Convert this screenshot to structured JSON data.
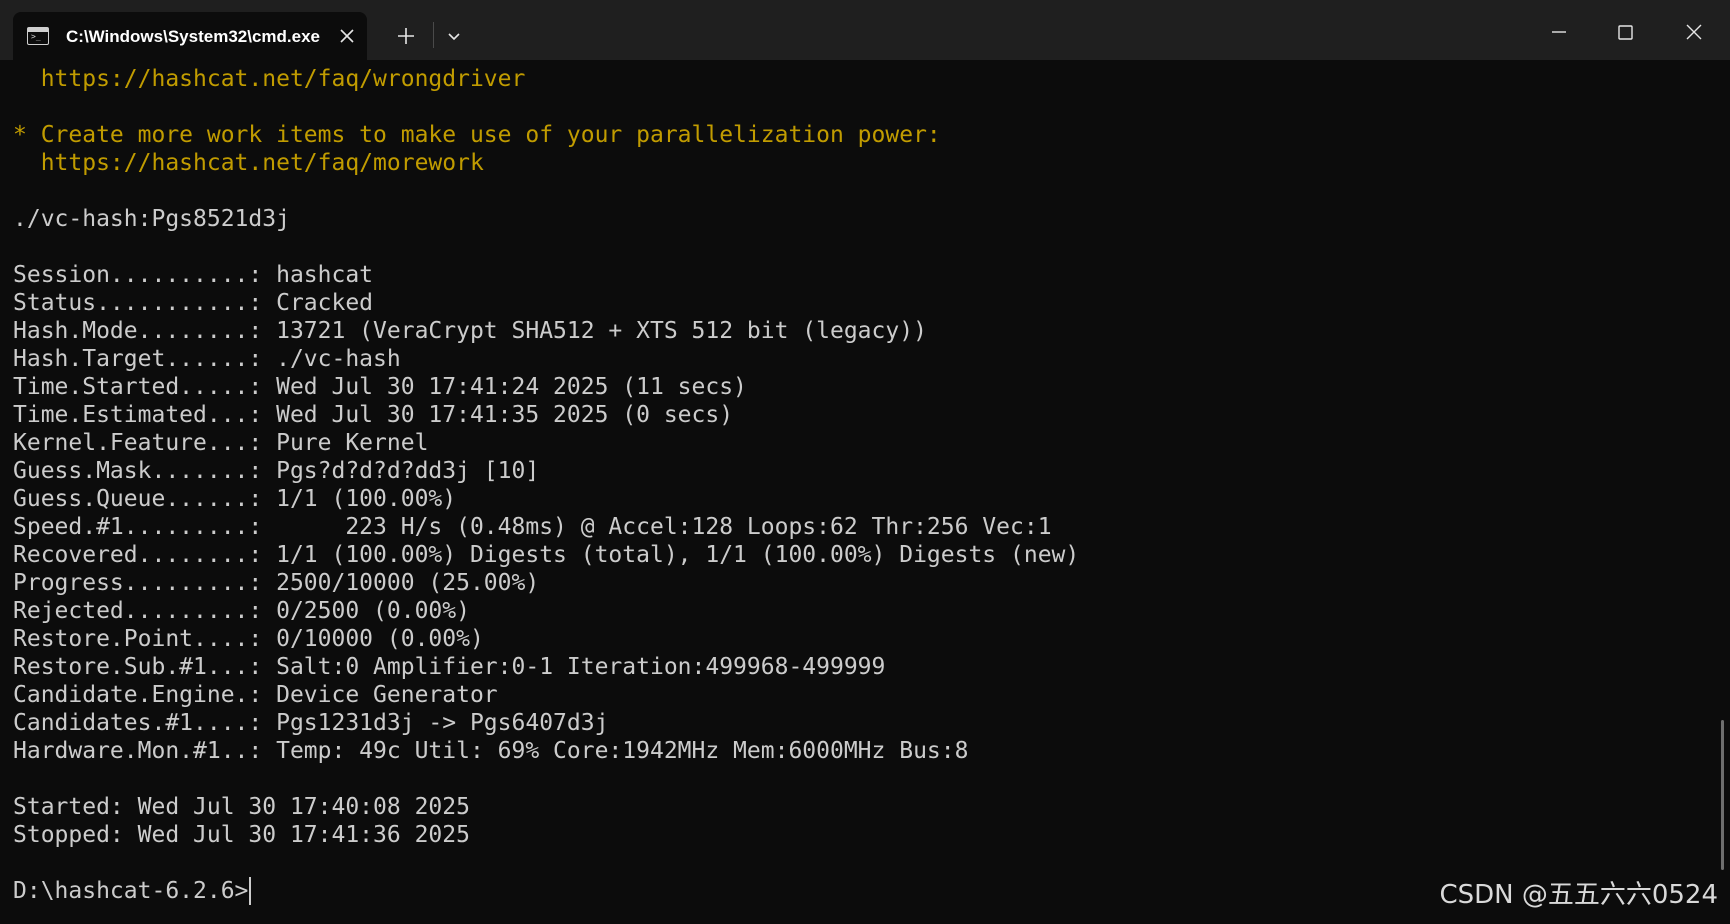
{
  "window": {
    "tab_title": "C:\\Windows\\System32\\cmd.exe",
    "tab_icon": "cmd-terminal-icon",
    "icons": {
      "tab_close": "close-icon",
      "new_tab": "plus-icon",
      "tab_dropdown": "chevron-down-icon",
      "minimize": "minimize-icon",
      "maximize": "maximize-icon",
      "close": "close-icon"
    }
  },
  "terminal": {
    "colors": {
      "background": "#0c0c0c",
      "text": "#cccccc",
      "warning": "#c19c00"
    },
    "lines": [
      {
        "text": "  https://hashcat.net/faq/wrongdriver",
        "color": "yellow"
      },
      {
        "text": "",
        "color": "default"
      },
      {
        "text": "* Create more work items to make use of your parallelization power:",
        "color": "yellow"
      },
      {
        "text": "  https://hashcat.net/faq/morework",
        "color": "yellow"
      },
      {
        "text": "",
        "color": "default"
      },
      {
        "text": "./vc-hash:Pgs8521d3j",
        "color": "default"
      },
      {
        "text": "",
        "color": "default"
      },
      {
        "text": "Session..........: hashcat",
        "color": "default"
      },
      {
        "text": "Status...........: Cracked",
        "color": "default"
      },
      {
        "text": "Hash.Mode........: 13721 (VeraCrypt SHA512 + XTS 512 bit (legacy))",
        "color": "default"
      },
      {
        "text": "Hash.Target......: ./vc-hash",
        "color": "default"
      },
      {
        "text": "Time.Started.....: Wed Jul 30 17:41:24 2025 (11 secs)",
        "color": "default"
      },
      {
        "text": "Time.Estimated...: Wed Jul 30 17:41:35 2025 (0 secs)",
        "color": "default"
      },
      {
        "text": "Kernel.Feature...: Pure Kernel",
        "color": "default"
      },
      {
        "text": "Guess.Mask.......: Pgs?d?d?d?dd3j [10]",
        "color": "default"
      },
      {
        "text": "Guess.Queue......: 1/1 (100.00%)",
        "color": "default"
      },
      {
        "text": "Speed.#1.........:      223 H/s (0.48ms) @ Accel:128 Loops:62 Thr:256 Vec:1",
        "color": "default"
      },
      {
        "text": "Recovered........: 1/1 (100.00%) Digests (total), 1/1 (100.00%) Digests (new)",
        "color": "default"
      },
      {
        "text": "Progress.........: 2500/10000 (25.00%)",
        "color": "default"
      },
      {
        "text": "Rejected.........: 0/2500 (0.00%)",
        "color": "default"
      },
      {
        "text": "Restore.Point....: 0/10000 (0.00%)",
        "color": "default"
      },
      {
        "text": "Restore.Sub.#1...: Salt:0 Amplifier:0-1 Iteration:499968-499999",
        "color": "default"
      },
      {
        "text": "Candidate.Engine.: Device Generator",
        "color": "default"
      },
      {
        "text": "Candidates.#1....: Pgs1231d3j -> Pgs6407d3j",
        "color": "default"
      },
      {
        "text": "Hardware.Mon.#1..: Temp: 49c Util: 69% Core:1942MHz Mem:6000MHz Bus:8",
        "color": "default"
      },
      {
        "text": "",
        "color": "default"
      },
      {
        "text": "Started: Wed Jul 30 17:40:08 2025",
        "color": "default"
      },
      {
        "text": "Stopped: Wed Jul 30 17:41:36 2025",
        "color": "default"
      },
      {
        "text": "",
        "color": "default"
      }
    ],
    "prompt": "D:\\hashcat-6.2.6>"
  },
  "watermark": "CSDN @五五六六0524"
}
